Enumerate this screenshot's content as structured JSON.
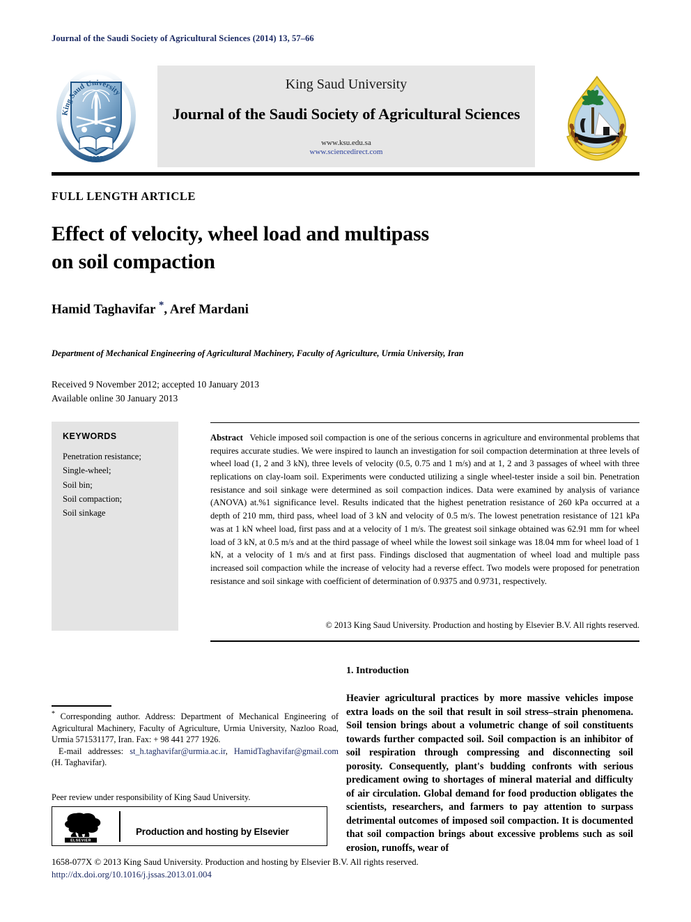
{
  "running_head": "Journal of the Saudi Society of Agricultural Sciences (2014) 13, 57–66",
  "masthead": {
    "publisher": "King Saud University",
    "journal_title": "Journal of the Saudi Society of Agricultural Sciences",
    "url_ksu": "www.ksu.edu.sa",
    "url_sciencedirect": "www.sciencedirect.com",
    "left_logo_name": "king-saud-university-shield-logo",
    "left_logo_text_en_top": "King Saud",
    "left_logo_text_en_bottom": "University",
    "left_logo_year": "1957",
    "right_logo_name": "saudi-society-agricultural-sciences-logo"
  },
  "article": {
    "type": "FULL LENGTH ARTICLE",
    "title_line1": "Effect of velocity, wheel load and multipass",
    "title_line2": "on soil compaction",
    "authors": "Hamid Taghavifar ",
    "corresponding_marker": "*",
    "authors_rest": ", Aref Mardani",
    "affiliation": "Department of Mechanical Engineering of Agricultural Machinery, Faculty of Agriculture, Urmia University, Iran",
    "history_line1": "Received 9 November 2012; accepted 10 January 2013",
    "history_line2": "Available online 30 January 2013"
  },
  "keywords": {
    "heading": "KEYWORDS",
    "items": [
      "Penetration resistance;",
      "Single-wheel;",
      "Soil bin;",
      "Soil compaction;",
      "Soil sinkage"
    ]
  },
  "abstract": {
    "label": "Abstract",
    "body": "Vehicle imposed soil compaction is one of the serious concerns in agriculture and environmental problems that requires accurate studies. We were inspired to launch an investigation for soil compaction determination at three levels of wheel load (1, 2 and 3 kN), three levels of velocity (0.5, 0.75 and 1 m/s) and at 1, 2 and 3 passages of wheel with three replications on clay-loam soil. Experiments were conducted utilizing a single wheel-tester inside a soil bin. Penetration resistance and soil sinkage were determined as soil compaction indices. Data were examined by analysis of variance (ANOVA) at.%1 significance level. Results indicated that the highest penetration resistance of 260 kPa occurred at a depth of 210 mm, third pass, wheel load of 3 kN and velocity of 0.5 m/s. The lowest penetration resistance of 121 kPa was at 1 kN wheel load, first pass and at a velocity of 1 m/s. The greatest soil sinkage obtained was 62.91 mm for wheel load of 3 kN, at 0.5 m/s and at the third passage of wheel while the lowest soil sinkage was 18.04 mm for wheel load of 1 kN, at a velocity of 1 m/s and at first pass. Findings disclosed that augmentation of wheel load and multiple pass increased soil compaction while the increase of velocity had a reverse effect. Two models were proposed for penetration resistance and soil sinkage with coefficient of determination of 0.9375 and 0.9731, respectively.",
    "copyright": "© 2013 King Saud University. Production and hosting by Elsevier B.V. All rights reserved."
  },
  "introduction": {
    "heading": "1. Introduction",
    "paragraph": "Heavier agricultural practices by more massive vehicles impose extra loads on the soil that result in soil stress–strain phenomena. Soil tension brings about a volumetric change of soil constituents towards further compacted soil. Soil compaction is an inhibitor of soil respiration through compressing and disconnecting soil porosity. Consequently, plant's budding confronts with serious predicament owing to shortages of mineral material and difficulty of air circulation. Global demand for food production obligates the scientists, researchers, and farmers to pay attention to surpass detrimental outcomes of imposed soil compaction. It is documented that soil compaction brings about excessive problems such as soil erosion, runoffs, wear of"
  },
  "footnotes": {
    "corresponding_marker": "*",
    "corresponding": " Corresponding author. Address: Department of Mechanical Engineering of Agricultural Machinery, Faculty of Agriculture, Urmia University, Nazloo Road, Urmia 571531177, Iran. Fax: + 98 441 277 1926.",
    "email_label": "E-mail addresses: ",
    "email1": "st_h.taghavifar@urmia.ac.ir",
    "email_sep": ", ",
    "email2": "HamidTaghavifar@gmail.com",
    "email_suffix": " (H. Taghavifar).",
    "peer_review": "Peer review under responsibility of King Saud University."
  },
  "elsevier_box": {
    "logo_name": "elsevier-tree-logo",
    "logo_wordmark": "ELSEVIER",
    "text": "Production and hosting by Elsevier"
  },
  "footer": {
    "issn_copyright": "1658-077X © 2013 King Saud University. Production and hosting by Elsevier B.V. All rights reserved.",
    "doi": "http://dx.doi.org/10.1016/j.jssas.2013.01.004"
  },
  "colors": {
    "link": "#1b2a63",
    "banner_bg": "#e6e6e6",
    "keyword_bg": "#e4e4e4",
    "rule": "#000000"
  }
}
